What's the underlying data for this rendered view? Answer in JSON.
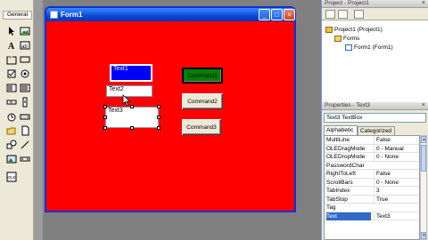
{
  "toolbox": {
    "header": "General",
    "tools": [
      "pointer-icon",
      "picturebox-icon",
      "label-icon",
      "textbox-icon",
      "frame-icon",
      "commandbutton-icon",
      "checkbox-icon",
      "optionbutton-icon",
      "combobox-icon",
      "listbox-icon",
      "hscrollbar-icon",
      "vscrollbar-icon",
      "timer-icon",
      "drivelistbox-icon",
      "dirlistbox-icon",
      "filelistbox-icon",
      "shape-icon",
      "line-icon",
      "image-icon",
      "data-icon",
      "ole-icon"
    ]
  },
  "form": {
    "title": "Form1",
    "minimize": "_",
    "maximize": "□",
    "close": "×",
    "back_color": "#ff0000",
    "controls": {
      "text1": "Text1",
      "text2": "Text2",
      "text3": "Text3",
      "command1": "Command1",
      "command2": "Command2",
      "command3": "Command3"
    }
  },
  "project": {
    "title": "Project - Project1",
    "close": "×",
    "tree": {
      "root": "Project1 (Project1)",
      "forms": "Forms",
      "form1": "Form1 (Form1)"
    }
  },
  "properties": {
    "title": "Properties - Text3",
    "close": "×",
    "object": "Text3  TextBox",
    "tabs": [
      "Alphabetic",
      "Categorized"
    ],
    "rows": [
      {
        "name": "MultiLine",
        "value": "False"
      },
      {
        "name": "OLEDragMode",
        "value": "0 - Manual"
      },
      {
        "name": "OLEDropMode",
        "value": "0 - None"
      },
      {
        "name": "PasswordChar",
        "value": ""
      },
      {
        "name": "RightToLeft",
        "value": "False"
      },
      {
        "name": "ScrollBars",
        "value": "0 - None"
      },
      {
        "name": "TabIndex",
        "value": "3"
      },
      {
        "name": "TabStop",
        "value": "True"
      },
      {
        "name": "Tag",
        "value": ""
      },
      {
        "name": "Text",
        "value": "Text3"
      }
    ]
  }
}
